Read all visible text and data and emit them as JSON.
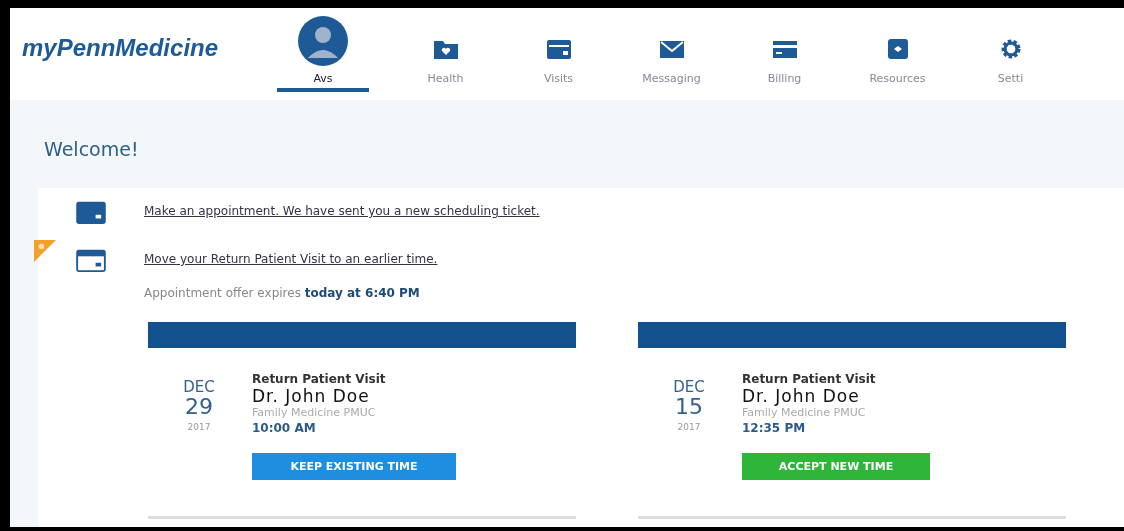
{
  "brand": "myPennMedicine",
  "nav": [
    {
      "label": "Avs",
      "kind": "avatar",
      "selected": true
    },
    {
      "label": "Health",
      "kind": "folder",
      "selected": false
    },
    {
      "label": "Visits",
      "kind": "calendar",
      "selected": false
    },
    {
      "label": "Messaging",
      "kind": "envelope",
      "selected": false
    },
    {
      "label": "Billing",
      "kind": "card",
      "selected": false
    },
    {
      "label": "Resources",
      "kind": "resources",
      "selected": false
    },
    {
      "label": "Setti",
      "kind": "gear",
      "selected": false
    }
  ],
  "heading": "Welcome!",
  "tasks": [
    {
      "link": "Make an appointment. We have sent you a new scheduling ticket.",
      "new": false
    },
    {
      "link": "Move your Return Patient Visit to an earlier time.",
      "new": true,
      "note": "Appointment offer expires **today at 6:40 PM**"
    }
  ],
  "offers": [
    {
      "month": "DEC",
      "day": "29",
      "year": "2017",
      "type": "Return Patient Visit",
      "provider": "Dr. John Doe",
      "department": "Family Medicine PMUC",
      "time": "10:00 AM",
      "button": "KEEP EXISTING TIME",
      "kind": "keep"
    },
    {
      "month": "DEC",
      "day": "15",
      "year": "2017",
      "type": "Return Patient Visit",
      "provider": "Dr. John Doe",
      "department": "Family Medicine PMUC",
      "time": "12:35 PM",
      "button": "ACCEPT NEW TIME",
      "kind": "accept"
    }
  ]
}
